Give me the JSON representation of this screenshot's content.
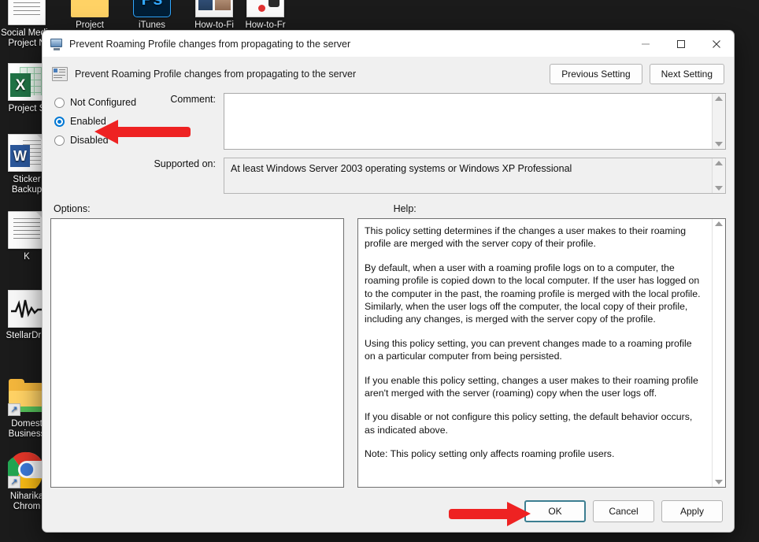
{
  "desktop": {
    "icons": [
      {
        "name": "social-media-project-notes",
        "label": "Social Media Project N",
        "type": "doc"
      },
      {
        "name": "project-folder",
        "label": "Project",
        "type": "folder-plain"
      },
      {
        "name": "itunes",
        "label": "iTunes",
        "type": "ps"
      },
      {
        "name": "how-to-fi-1",
        "label": "How-to-Fi",
        "type": "thumb"
      },
      {
        "name": "how-to-fr-2",
        "label": "How-to-Fr",
        "type": "thumb2"
      },
      {
        "name": "project-sheet",
        "label": "Project S",
        "type": "xls"
      },
      {
        "name": "sticker-backup",
        "label": "Sticker Backup",
        "type": "word"
      },
      {
        "name": "k-document",
        "label": "K",
        "type": "doc"
      },
      {
        "name": "stellardrive",
        "label": "StellarDriv",
        "type": "wave"
      },
      {
        "name": "domestic-business",
        "label": "Domest Business",
        "type": "folder"
      },
      {
        "name": "niharika-chrome",
        "label": "Niharika Chrom",
        "type": "chrome"
      }
    ]
  },
  "dialog": {
    "title": "Prevent Roaming Profile changes from propagating to the server",
    "window_controls": {
      "minimize": "Minimize",
      "maximize": "Maximize",
      "close": "Close"
    },
    "header": {
      "setting_title": "Prevent Roaming Profile changes from propagating to the server",
      "previous_button": "Previous Setting",
      "next_button": "Next Setting"
    },
    "state_options": [
      {
        "id": "not-configured",
        "label": "Not Configured",
        "selected": false
      },
      {
        "id": "enabled",
        "label": "Enabled",
        "selected": true
      },
      {
        "id": "disabled",
        "label": "Disabled",
        "selected": false
      }
    ],
    "comment": {
      "label": "Comment:",
      "value": "",
      "placeholder": ""
    },
    "supported_on": {
      "label": "Supported on:",
      "value": "At least Windows Server 2003 operating systems or Windows XP Professional"
    },
    "options_pane": {
      "label": "Options:",
      "content": ""
    },
    "help_pane": {
      "label": "Help:",
      "paragraphs": [
        "This policy setting determines if the changes a user makes to their roaming profile are merged with the server copy of their profile.",
        "By default, when a user with a roaming profile logs on to a computer, the roaming profile is copied down to the local computer. If the user has logged on to the computer in the past, the roaming profile is merged with the local profile. Similarly, when the user logs off the computer, the local copy of their profile, including any changes, is merged with the server copy of the profile.",
        "Using this policy setting, you can prevent changes made to a roaming profile on a particular computer from being persisted.",
        "If you enable this policy setting, changes a user makes to their roaming profile aren't merged with the server (roaming) copy when the user logs off.",
        "If you disable or not configure this policy setting, the default behavior occurs, as indicated above.",
        "Note: This policy setting only affects roaming profile users."
      ]
    },
    "footer": {
      "ok": "OK",
      "cancel": "Cancel",
      "apply": "Apply"
    }
  },
  "annotations": {
    "color": "#ee2222",
    "arrows": [
      {
        "name": "arrow-pointing-to-enabled",
        "direction": "left",
        "target": "Enabled"
      },
      {
        "name": "arrow-pointing-to-ok",
        "direction": "right",
        "target": "OK"
      }
    ]
  }
}
